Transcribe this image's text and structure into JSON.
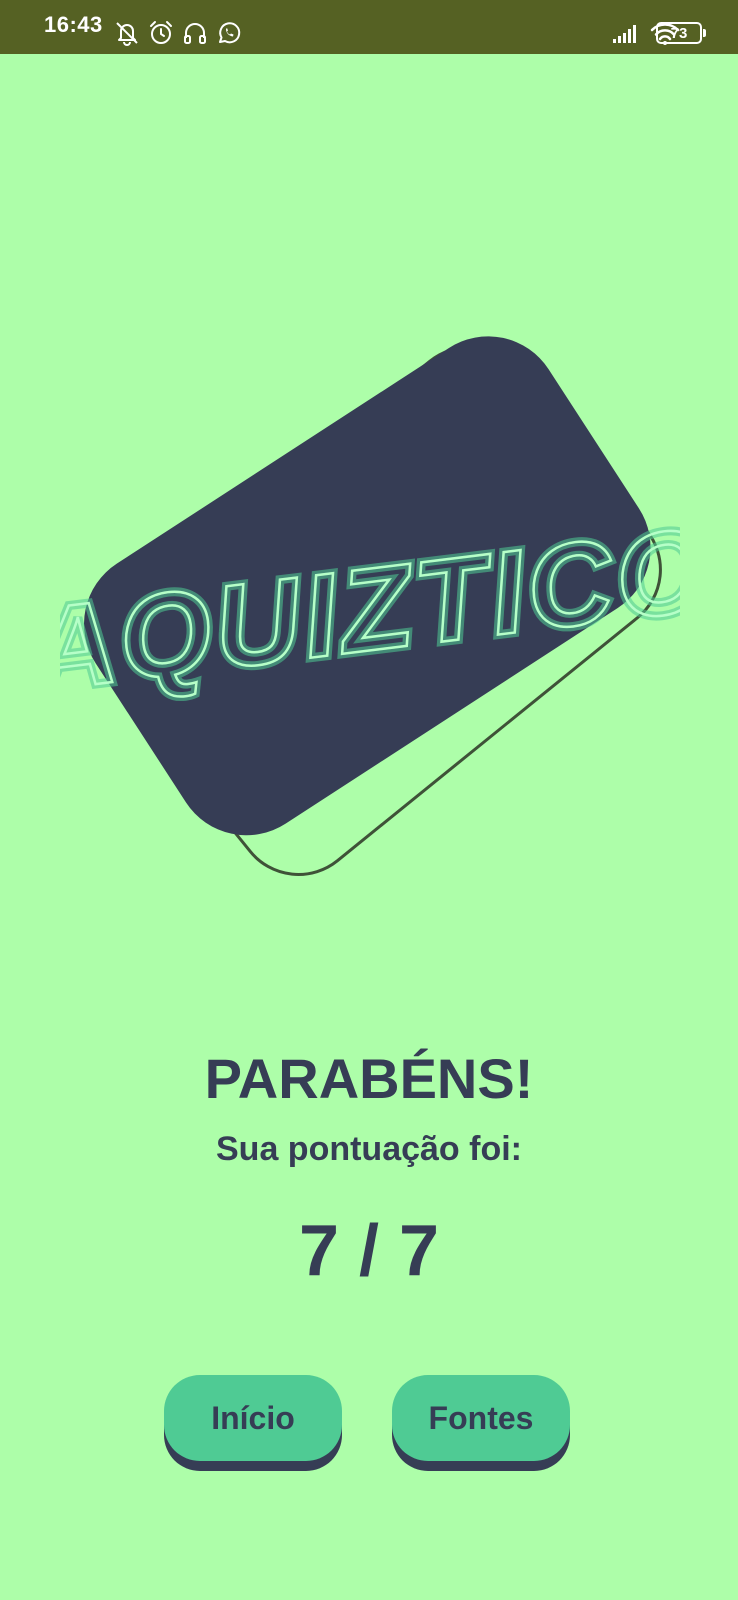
{
  "status_bar": {
    "time": "16:43",
    "battery": "73",
    "left_icons": [
      "bell-off-icon",
      "alarm-icon",
      "headset-icon",
      "whatsapp-icon"
    ],
    "right_icons": [
      "signal-icon",
      "wifi-icon",
      "battery-icon"
    ]
  },
  "logo": {
    "text": "AQUIZTICO"
  },
  "result": {
    "title": "PARABÉNS!",
    "label": "Sua pontuação foi:",
    "score": "7 / 7"
  },
  "buttons": {
    "home_label": "Início",
    "sources_label": "Fontes"
  },
  "colors": {
    "background": "#adfea9",
    "status_bar": "#556123",
    "dark": "#363d55",
    "accent": "#4fcb94",
    "neon": "#9ef5b8"
  }
}
